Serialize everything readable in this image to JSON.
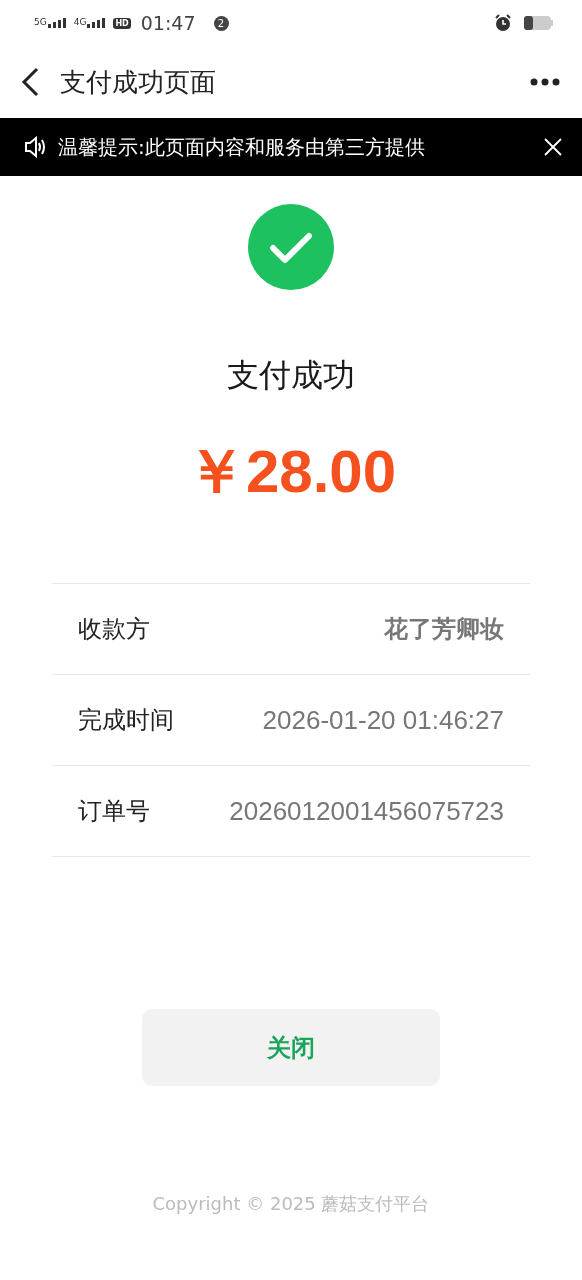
{
  "status_bar": {
    "network_1": "5G",
    "network_2": "4G",
    "hd": "HD",
    "time": "01:47",
    "notification_count": "2"
  },
  "nav": {
    "title": "支付成功页面"
  },
  "notice": {
    "text": "温馨提示:此页面内容和服务由第三方提供"
  },
  "result": {
    "title": "支付成功",
    "amount": "￥28.00"
  },
  "details": [
    {
      "label": "收款方",
      "value": "花了芳卿妆",
      "bold": true
    },
    {
      "label": "完成时间",
      "value": "2026-01-20 01:46:27",
      "bold": false
    },
    {
      "label": "订单号",
      "value": "2026012001456075723",
      "bold": false
    }
  ],
  "close_button": "关闭",
  "footer": "Copyright © 2025 蘑菇支付平台"
}
